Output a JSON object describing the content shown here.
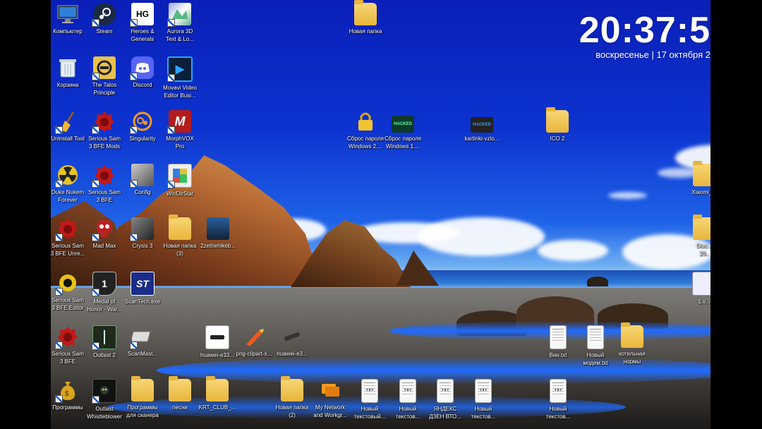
{
  "clock": {
    "time": "20:37:5",
    "date": "воскресенье | 17 октября 2"
  },
  "desktop_icons": {
    "kompyuter": "Компьютер",
    "steam": "Steam",
    "heroes_generals": "Heroes &\nGenerals",
    "aurora": "Aurora 3D\nText & Lo...",
    "novaya_papka_top": "Новая папка",
    "korzina": "Корзина",
    "talos": "The Talos\nPrinciple",
    "discord": "Discord",
    "movavi": "Movavi Video\nEditor Busi...",
    "uninstall_tool": "Uninstall Tool",
    "ss3_mods": "Serious Sam\n3 BFE Mods",
    "singularity": "Singularity",
    "morphvox": "MorphVOX\nPro",
    "sbros1": "Сброс пароля\nWindows 2....",
    "sbros2": "Сброс пароля\nWindows 1....",
    "kartinki": "kartinki-vzlo...",
    "ico2": "ICO 2",
    "duke": "Duke Nukem\nForever",
    "ss3_bfe": "Serious Sam\n3 BFE",
    "config": "Config",
    "windirstat": "WinDirStat",
    "xiaomi": "Xiaomi_...",
    "ss_unreal": "Serious Sam\n3 BFE Unre...",
    "mad_max": "Mad Max",
    "crysis3": "Crysis 3",
    "novaya_papka3": "Новая папка\n(3)",
    "zzz": "2zethehikeb...",
    "disc_right": "Disc...\n20..",
    "ss_editor": "Serious Sam\n3 BFE Editor",
    "medal": "Medal of\nHonor - War...",
    "scantech": "ScanTech.exe",
    "v1": "1.v...",
    "ss3_bfe2": "Serious Sam\n3 BFE",
    "outlast2": "Outlast 2",
    "scanmast": "ScanMast...",
    "huawei1": "huawei-e33...",
    "pngclip": "png-clipart-x...",
    "huawei2": "huawei-e3...",
    "vin": "Вин.txt",
    "noviy_modem": "Новый\nмодем.txt",
    "kotelnaya": "котельная\nнормы",
    "programmy": "Программы",
    "outlast_wb": "Outlast\nWhistleblower",
    "programmy_scan": "Программы\nдля сканера",
    "pesni": "песни",
    "krt": "KRT_CLUB_...",
    "novaya_papka2": "Новая папка\n(2)",
    "network": "My Network\nand Workgr...",
    "txt1": "Новый\nтекстовый...",
    "txt2": "Новый\nтекстов...",
    "yandex": "ЯНДЕКС\nДЗЕН ВТО...",
    "txt3": "Новый\nтекстов...",
    "txt4": "Новый\nтекстов..."
  },
  "glyph_text": {
    "hg": "HG",
    "movavi": "▶",
    "morph": "M",
    "hacked": "HACKED",
    "st": "ST",
    "txt": "TXT",
    "medal": "1"
  },
  "colors": {
    "wallpaper_sky": "#0d33cf",
    "clock_text": "#ffffff",
    "folder": "#e9b53d"
  }
}
